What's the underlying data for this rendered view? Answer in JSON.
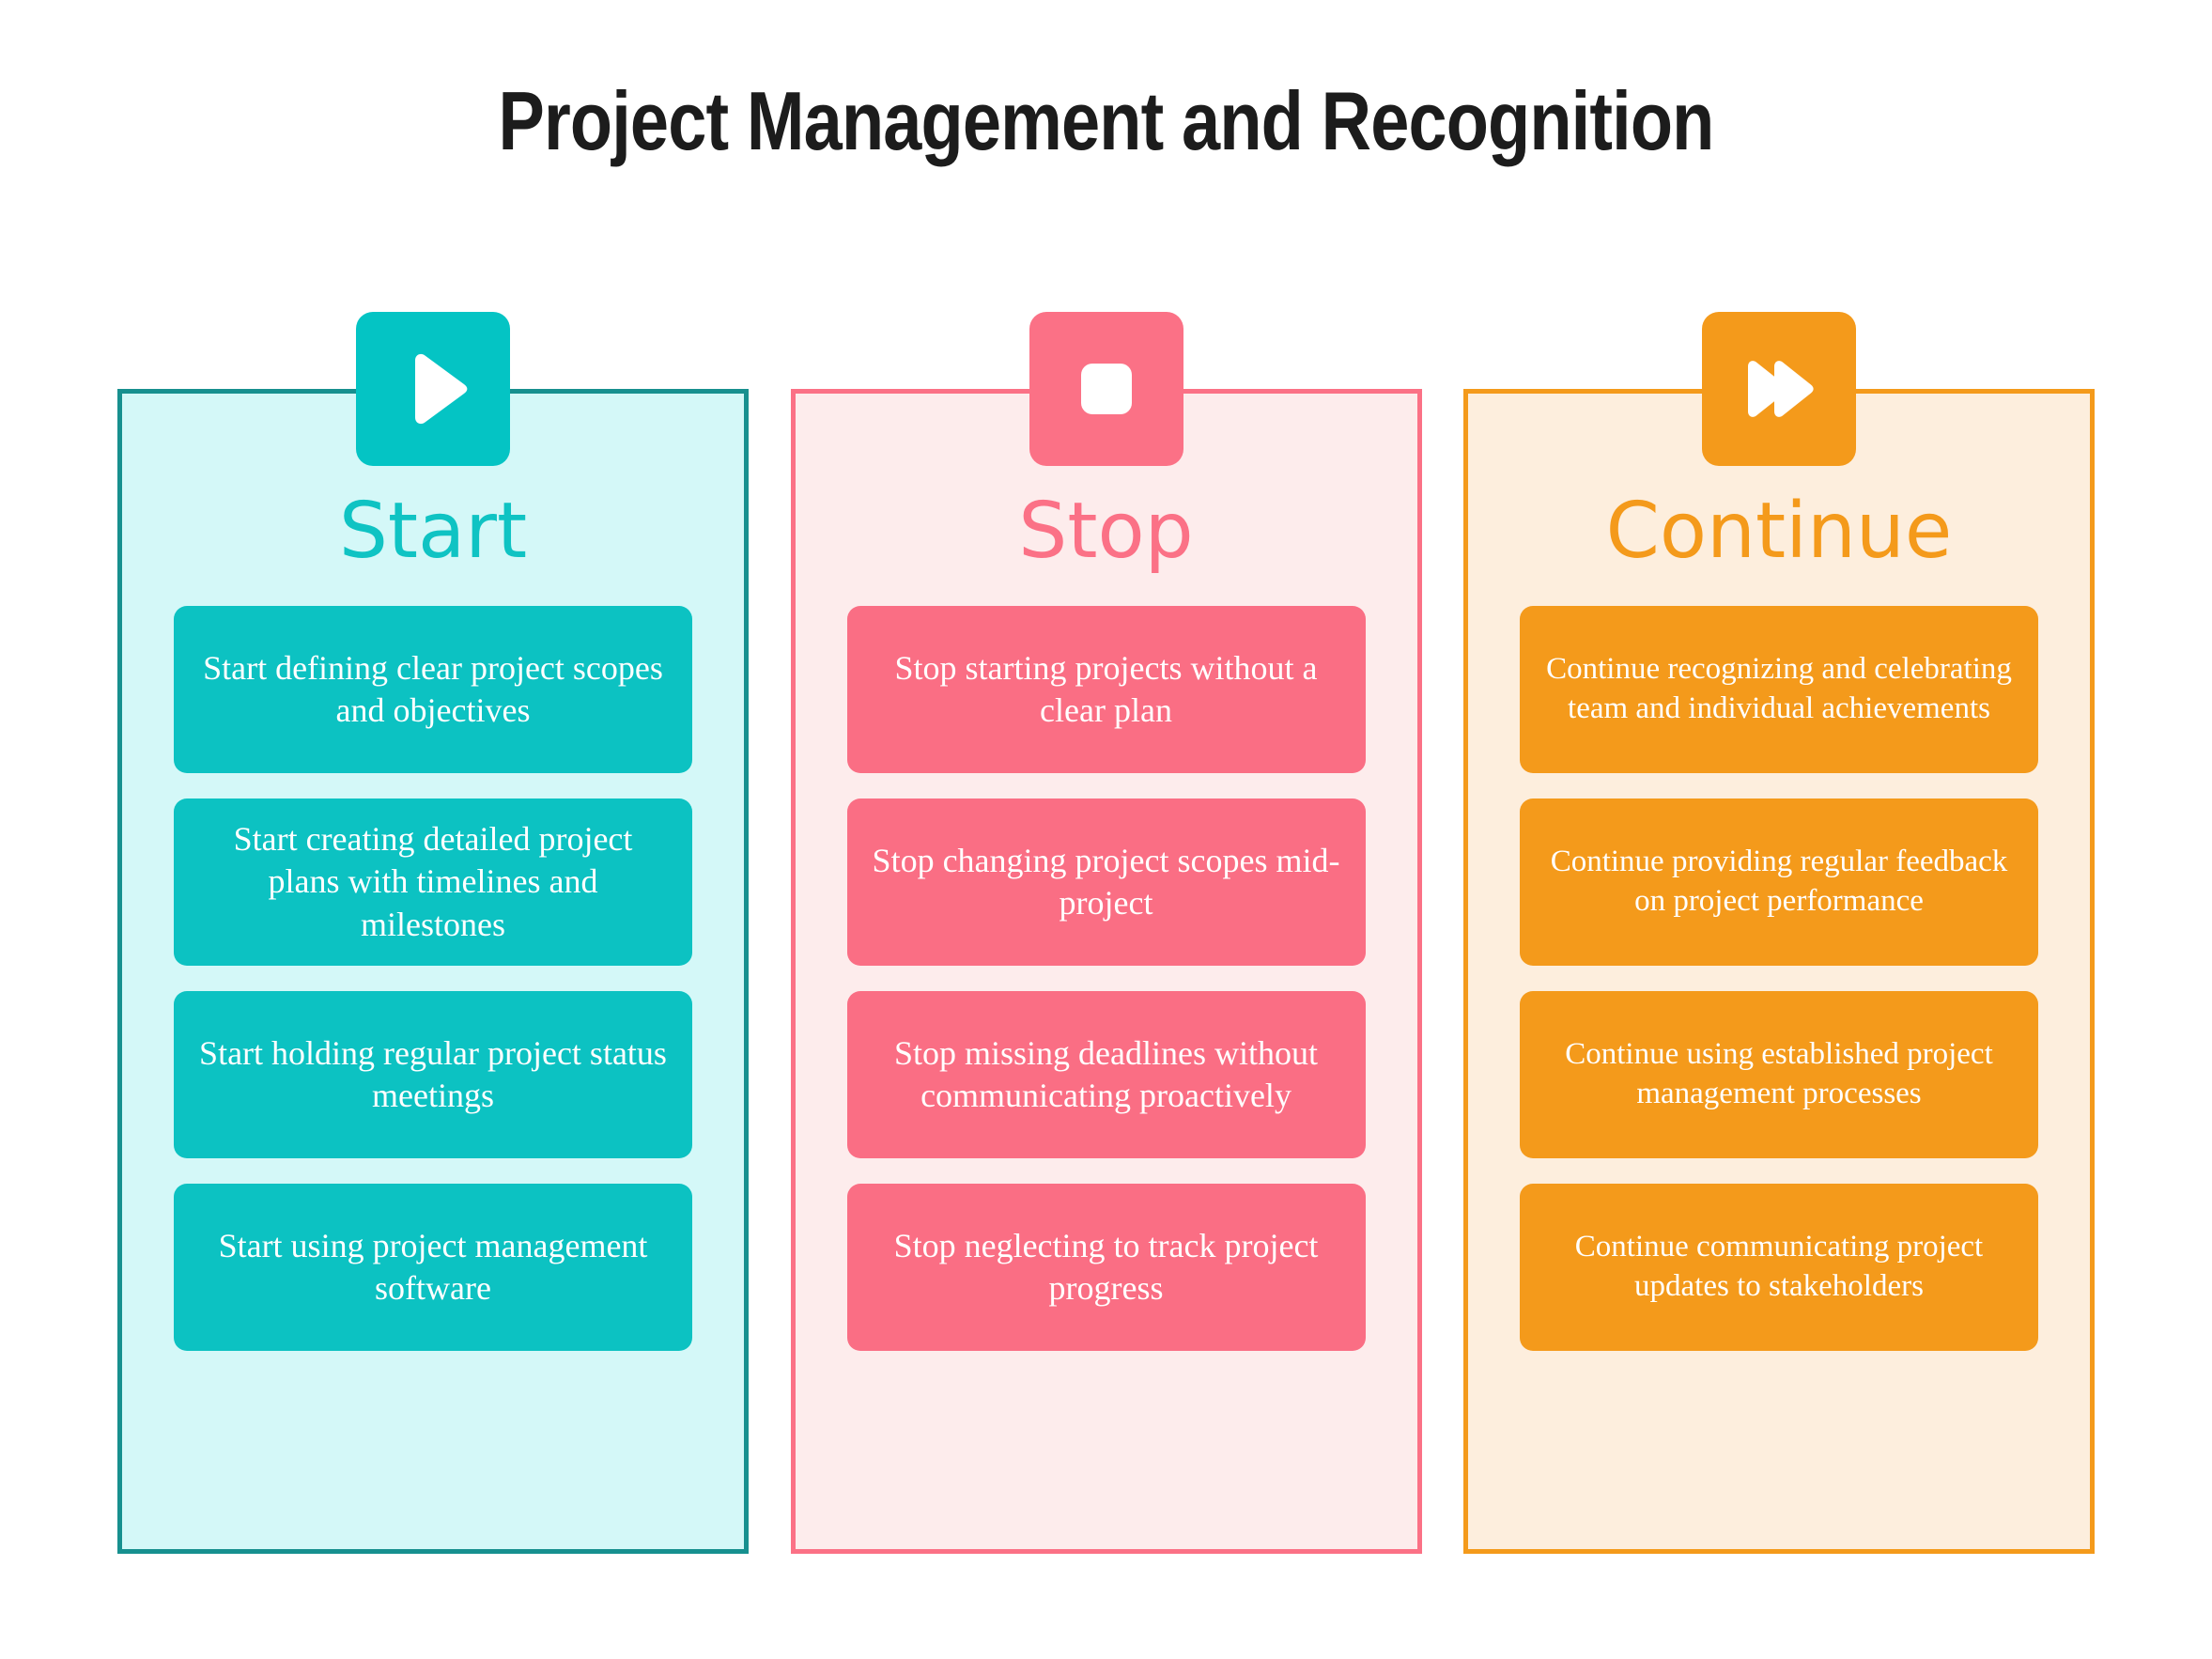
{
  "title": "Project Management and Recognition",
  "colors": {
    "start_accent": "#04c4c4",
    "start_panel_bg": "#d4f8f8",
    "start_border": "#17908f",
    "stop_accent": "#fb7186",
    "stop_panel_bg": "#fdecec",
    "stop_border": "#fb7186",
    "continue_accent": "#f49a1b",
    "continue_panel_bg": "#fdeedd",
    "continue_border": "#f49a1b",
    "title_color": "#1c1c1c",
    "card_text_color": "#ffffff"
  },
  "columns": [
    {
      "key": "start",
      "heading": "Start",
      "icon": "play-icon",
      "cards": [
        {
          "text": "Start defining clear project scopes and objectives"
        },
        {
          "text": "Start creating detailed project plans with timelines and milestones"
        },
        {
          "text": "Start holding regular project status meetings"
        },
        {
          "text": "Start using project management software"
        }
      ]
    },
    {
      "key": "stop",
      "heading": "Stop",
      "icon": "stop-square-icon",
      "cards": [
        {
          "text": "Stop starting projects without a clear plan"
        },
        {
          "text": "Stop changing project scopes mid-project"
        },
        {
          "text": "Stop missing deadlines without communicating proactively"
        },
        {
          "text": "Stop neglecting to track project progress"
        }
      ]
    },
    {
      "key": "continue",
      "heading": "Continue",
      "icon": "fast-forward-icon",
      "cards": [
        {
          "text": "Continue recognizing and celebrating team and individual achievements"
        },
        {
          "text": "Continue providing regular feedback on project performance"
        },
        {
          "text": "Continue using established project management processes"
        },
        {
          "text": "Continue communicating project updates to stakeholders"
        }
      ]
    }
  ]
}
